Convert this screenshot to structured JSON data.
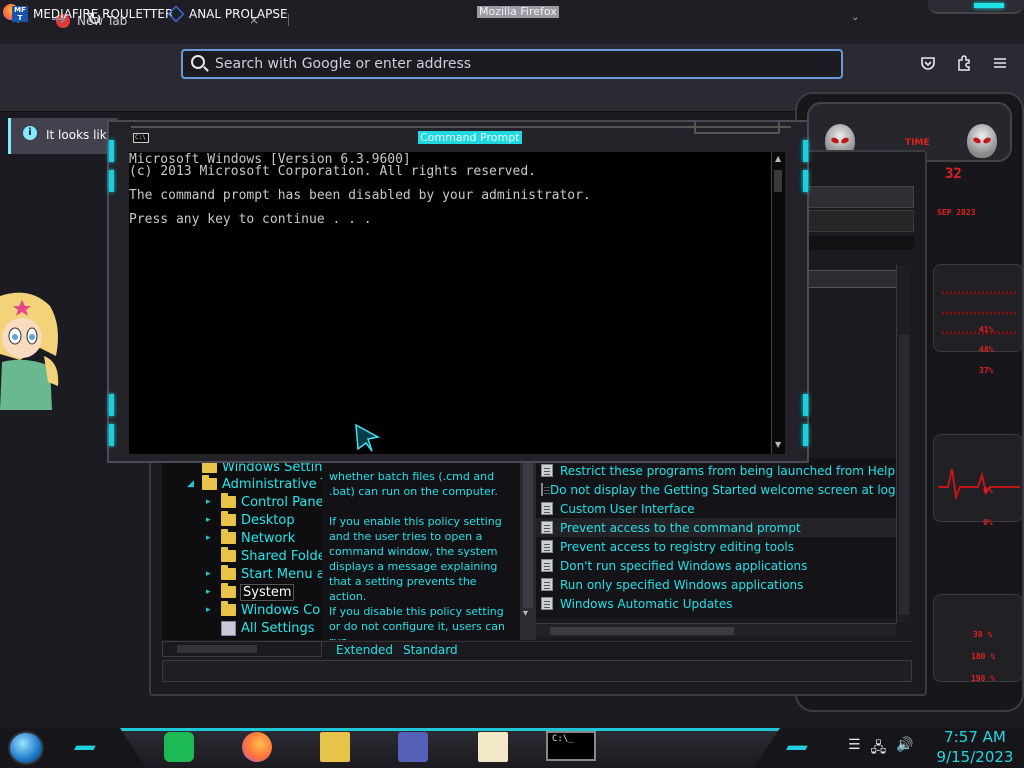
{
  "browser": {
    "window_title": "Mozilla Firefox",
    "tab": {
      "label": "New Tab",
      "close": "×"
    },
    "tab_list_glyph": "⌄",
    "nav": {
      "back": "←",
      "forward": "→",
      "reload": "↻"
    },
    "search": {
      "placeholder": "Search with Google or enter address",
      "value": ""
    },
    "toolbar_icons": [
      "pocket-icon",
      "extensions-icon",
      "menu-icon"
    ],
    "bookmarks": [
      {
        "label": "MEDIAFIRE ROULETTER",
        "icon_text": "MF T"
      },
      {
        "label": "ANAL PROLAPSE"
      }
    ],
    "notice": {
      "text": "It looks like",
      "icon": "i"
    }
  },
  "gadget": {
    "time_label": "TIME",
    "readouts": [
      "41%",
      "48%",
      "37%",
      "0%",
      "0%",
      "38 %",
      "180 %",
      "198 %"
    ],
    "clock_digits": "32",
    "date_text": "SEP 2023"
  },
  "gpedit": {
    "tree": [
      {
        "label": "Windows Settin",
        "indent": 0,
        "arrow": ""
      },
      {
        "label": "Administrative T",
        "indent": 0,
        "arrow": "◢"
      },
      {
        "label": "Control Panel",
        "indent": 1,
        "arrow": "▸"
      },
      {
        "label": "Desktop",
        "indent": 1,
        "arrow": "▸"
      },
      {
        "label": "Network",
        "indent": 1,
        "arrow": "▸"
      },
      {
        "label": "Shared Folde",
        "indent": 1,
        "arrow": ""
      },
      {
        "label": "Start Menu a",
        "indent": 1,
        "arrow": "▸"
      },
      {
        "label": "System",
        "indent": 1,
        "arrow": "▸",
        "selected": true
      },
      {
        "label": "Windows Co",
        "indent": 1,
        "arrow": "▸"
      },
      {
        "label": "All Settings",
        "indent": 1,
        "arrow": "",
        "icon": "settings"
      }
    ],
    "description": [
      "whether batch files (.cmd and .bat) can run on the computer.",
      "If you enable this policy setting and the user tries to open a command window, the system displays a message explaining that a setting prevents the action.",
      "If you disable this policy setting or do not configure it, users can run"
    ],
    "settings": [
      {
        "label": "Restrict these programs from being launched from Help"
      },
      {
        "label": "Do not display the Getting Started welcome screen at logon"
      },
      {
        "label": "Custom User Interface"
      },
      {
        "label": "Prevent access to the command prompt",
        "selected": true
      },
      {
        "label": "Prevent access to registry editing tools"
      },
      {
        "label": "Don't run specified Windows applications"
      },
      {
        "label": "Run only specified Windows applications"
      },
      {
        "label": "Windows Automatic Updates"
      }
    ],
    "view_tabs": [
      "Extended",
      "Standard"
    ]
  },
  "cmd": {
    "title": "Command Prompt",
    "icon_text": "C:\\",
    "lines": [
      "Microsoft Windows [Version 6.3.9600]",
      "(c) 2013 Microsoft Corporation. All rights reserved.",
      "",
      "The command prompt has been disabled by your administrator.",
      "",
      "Press any key to continue . . ."
    ]
  },
  "taskbar": {
    "apps": [
      "spotify-icon",
      "firefox-icon",
      "file-explorer-icon",
      "virtual-machine-icon",
      "notepad-icon",
      "command-prompt-icon"
    ],
    "cmd_icon_text": "C:\\_",
    "tray_icons": [
      "action-center-icon",
      "network-icon",
      "volume-icon"
    ],
    "time": "7:57 AM",
    "date": "9/15/2023"
  },
  "colors": {
    "accent_cyan": "#20e0e8",
    "alien_red": "#e02020",
    "firefox_bg": "#1c1b22",
    "url_focus": "#6a9bd8"
  }
}
